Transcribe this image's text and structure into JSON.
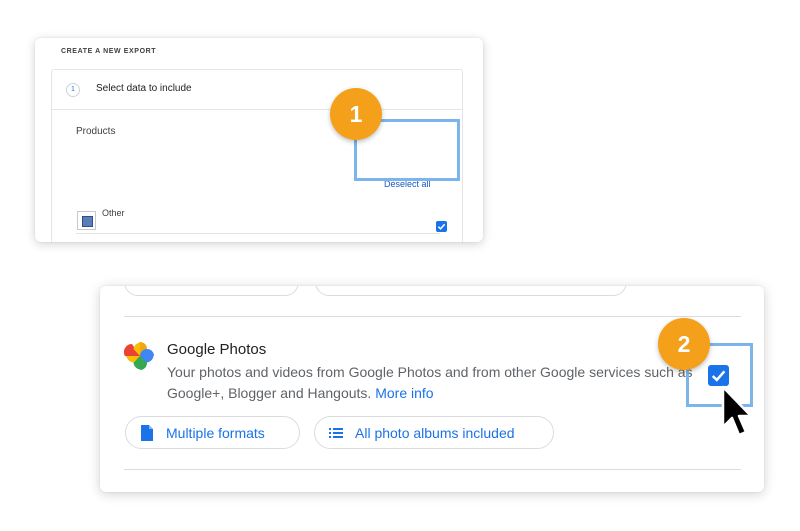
{
  "export_card": {
    "heading": "CREATE A NEW EXPORT",
    "step_number": "1",
    "step_label": "Select data to include",
    "section_label": "Products",
    "deselect_label": "Deselect all",
    "product_name": "Other",
    "product_checked": true
  },
  "badges": {
    "first": "1",
    "second": "2"
  },
  "photos_card": {
    "title": "Google Photos",
    "description": "Your photos and videos from Google Photos and from other Google services such as Google+, Blogger and Hangouts.",
    "more_info": "More info",
    "formats_label": "Multiple formats",
    "albums_label": "All photo albums included",
    "checked": true
  },
  "colors": {
    "accent_blue": "#1a73e8",
    "highlight_blue": "#7cb5ec",
    "badge_orange": "#f5a01a"
  },
  "icons": {
    "product_icon": "other-product-icon",
    "formats_icon": "document-icon",
    "albums_icon": "list-icon",
    "check_icon": "checkmark-icon",
    "cursor_icon": "mouse-pointer-icon"
  }
}
